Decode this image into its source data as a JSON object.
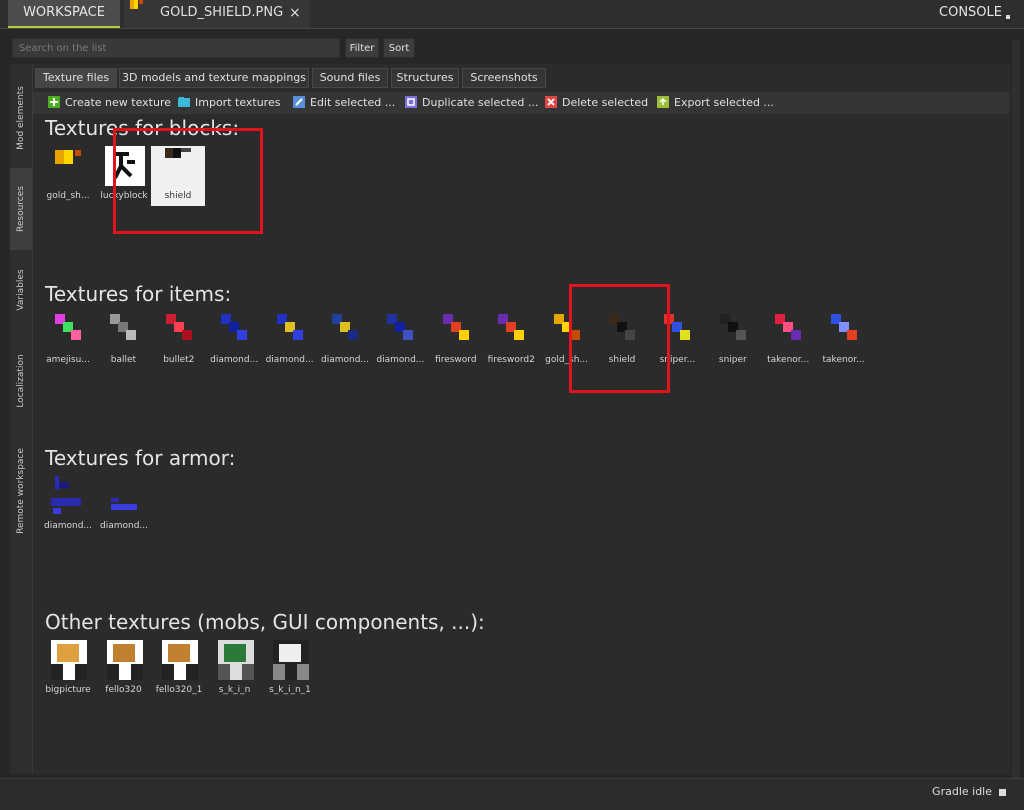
{
  "tabs": {
    "workspace": "WORKSPACE",
    "file": "GOLD_SHIELD.PNG",
    "file_close": "×",
    "console": "CONSOLE"
  },
  "search": {
    "placeholder": "Search on the list",
    "filter": "Filter",
    "sort": "Sort"
  },
  "sidebar": {
    "items": [
      "Mod elements",
      "Resources",
      "Variables",
      "Localization",
      "Remote workspace"
    ],
    "active": "Resources"
  },
  "subtabs": [
    "Texture files",
    "3D models and texture mappings",
    "Sound files",
    "Structures",
    "Screenshots"
  ],
  "toolbar": {
    "create": "Create new texture",
    "import": "Import textures",
    "edit": "Edit selected ...",
    "duplicate": "Duplicate selected ...",
    "delete": "Delete selected",
    "export": "Export selected ..."
  },
  "sections": {
    "blocks": {
      "title": "Textures for blocks:",
      "items": [
        "gold_sh...",
        "luckyblock",
        "shield"
      ]
    },
    "items": {
      "title": "Textures for items:",
      "items": [
        "amejisu...",
        "ballet",
        "bullet2",
        "diamond...",
        "diamond...",
        "diamond...",
        "diamond...",
        "firesword",
        "firesword2",
        "gold_sh...",
        "shield",
        "sniper...",
        "sniper",
        "takenor...",
        "takenor..."
      ]
    },
    "armor": {
      "title": "Textures for armor:",
      "items": [
        "diamond...",
        "diamond..."
      ]
    },
    "other": {
      "title": "Other textures (mobs, GUI components, ...):",
      "items": [
        "bigpicture",
        "fello320",
        "fello320_1",
        "s_k_i_n",
        "s_k_i_n_1"
      ]
    }
  },
  "status": {
    "text": "Gradle idle"
  },
  "colors": {
    "accent": "#b5cd3f",
    "highlight": "#e0141c",
    "background": "#272727"
  }
}
